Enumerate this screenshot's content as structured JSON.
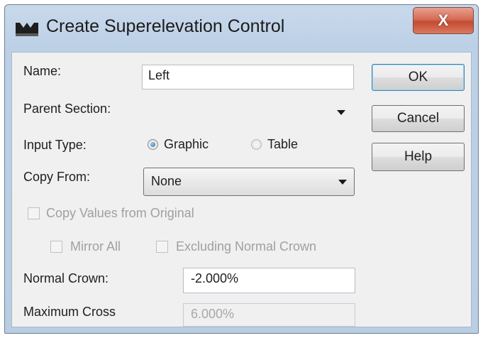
{
  "window": {
    "title": "Create Superelevation Control",
    "close_label": "X"
  },
  "form": {
    "name_label": "Name:",
    "name_value": "Left",
    "parent_section_label": "Parent Section:",
    "parent_section_value": "",
    "input_type_label": "Input Type:",
    "input_type_options": [
      "Graphic",
      "Table"
    ],
    "input_type_selected": "Graphic",
    "copy_from_label": "Copy From:",
    "copy_from_value": "None",
    "copy_values_label": "Copy Values from Original",
    "mirror_all_label": "Mirror All",
    "excluding_normal_crown_label": "Excluding Normal Crown",
    "normal_crown_label": "Normal Crown:",
    "normal_crown_value": "-2.000%",
    "maximum_cross_label": "Maximum Cross",
    "maximum_cross_value": "6.000%"
  },
  "buttons": {
    "ok": "OK",
    "cancel": "Cancel",
    "help": "Help"
  },
  "icons": {
    "app": "app-icon",
    "close": "close-icon",
    "dropdown": "chevron-down-icon"
  }
}
